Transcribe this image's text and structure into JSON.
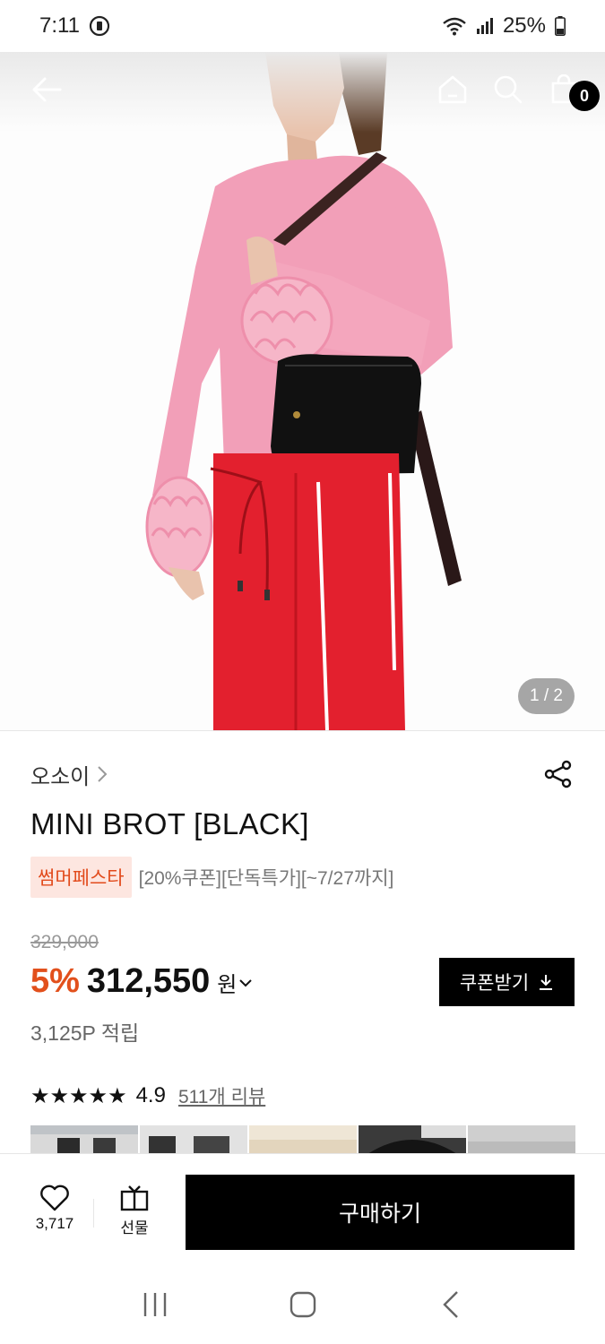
{
  "status_bar": {
    "time": "7:11",
    "battery": "25%"
  },
  "nav": {
    "cart_count": "0"
  },
  "hero": {
    "page_indicator": "1 / 2"
  },
  "product": {
    "brand": "오소이",
    "title": "MINI BROT [BLACK]",
    "promo_tag": "썸머페스타",
    "promo_text": "[20%쿠폰][단독특가][~7/27까지]",
    "original_price": "329,000",
    "discount": "5%",
    "price": "312,550",
    "currency": "원",
    "coupon_label": "쿠폰받기",
    "points": "3,125P 적립",
    "stars": "★★★★★",
    "rating": "4.9",
    "review_link": "511개 리뷰"
  },
  "bottom_bar": {
    "like_count": "3,717",
    "gift_label": "선물",
    "buy_label": "구매하기"
  },
  "colors": {
    "accent": "#e2501c",
    "promo_bg": "#fde6e0",
    "dark": "#000000"
  }
}
